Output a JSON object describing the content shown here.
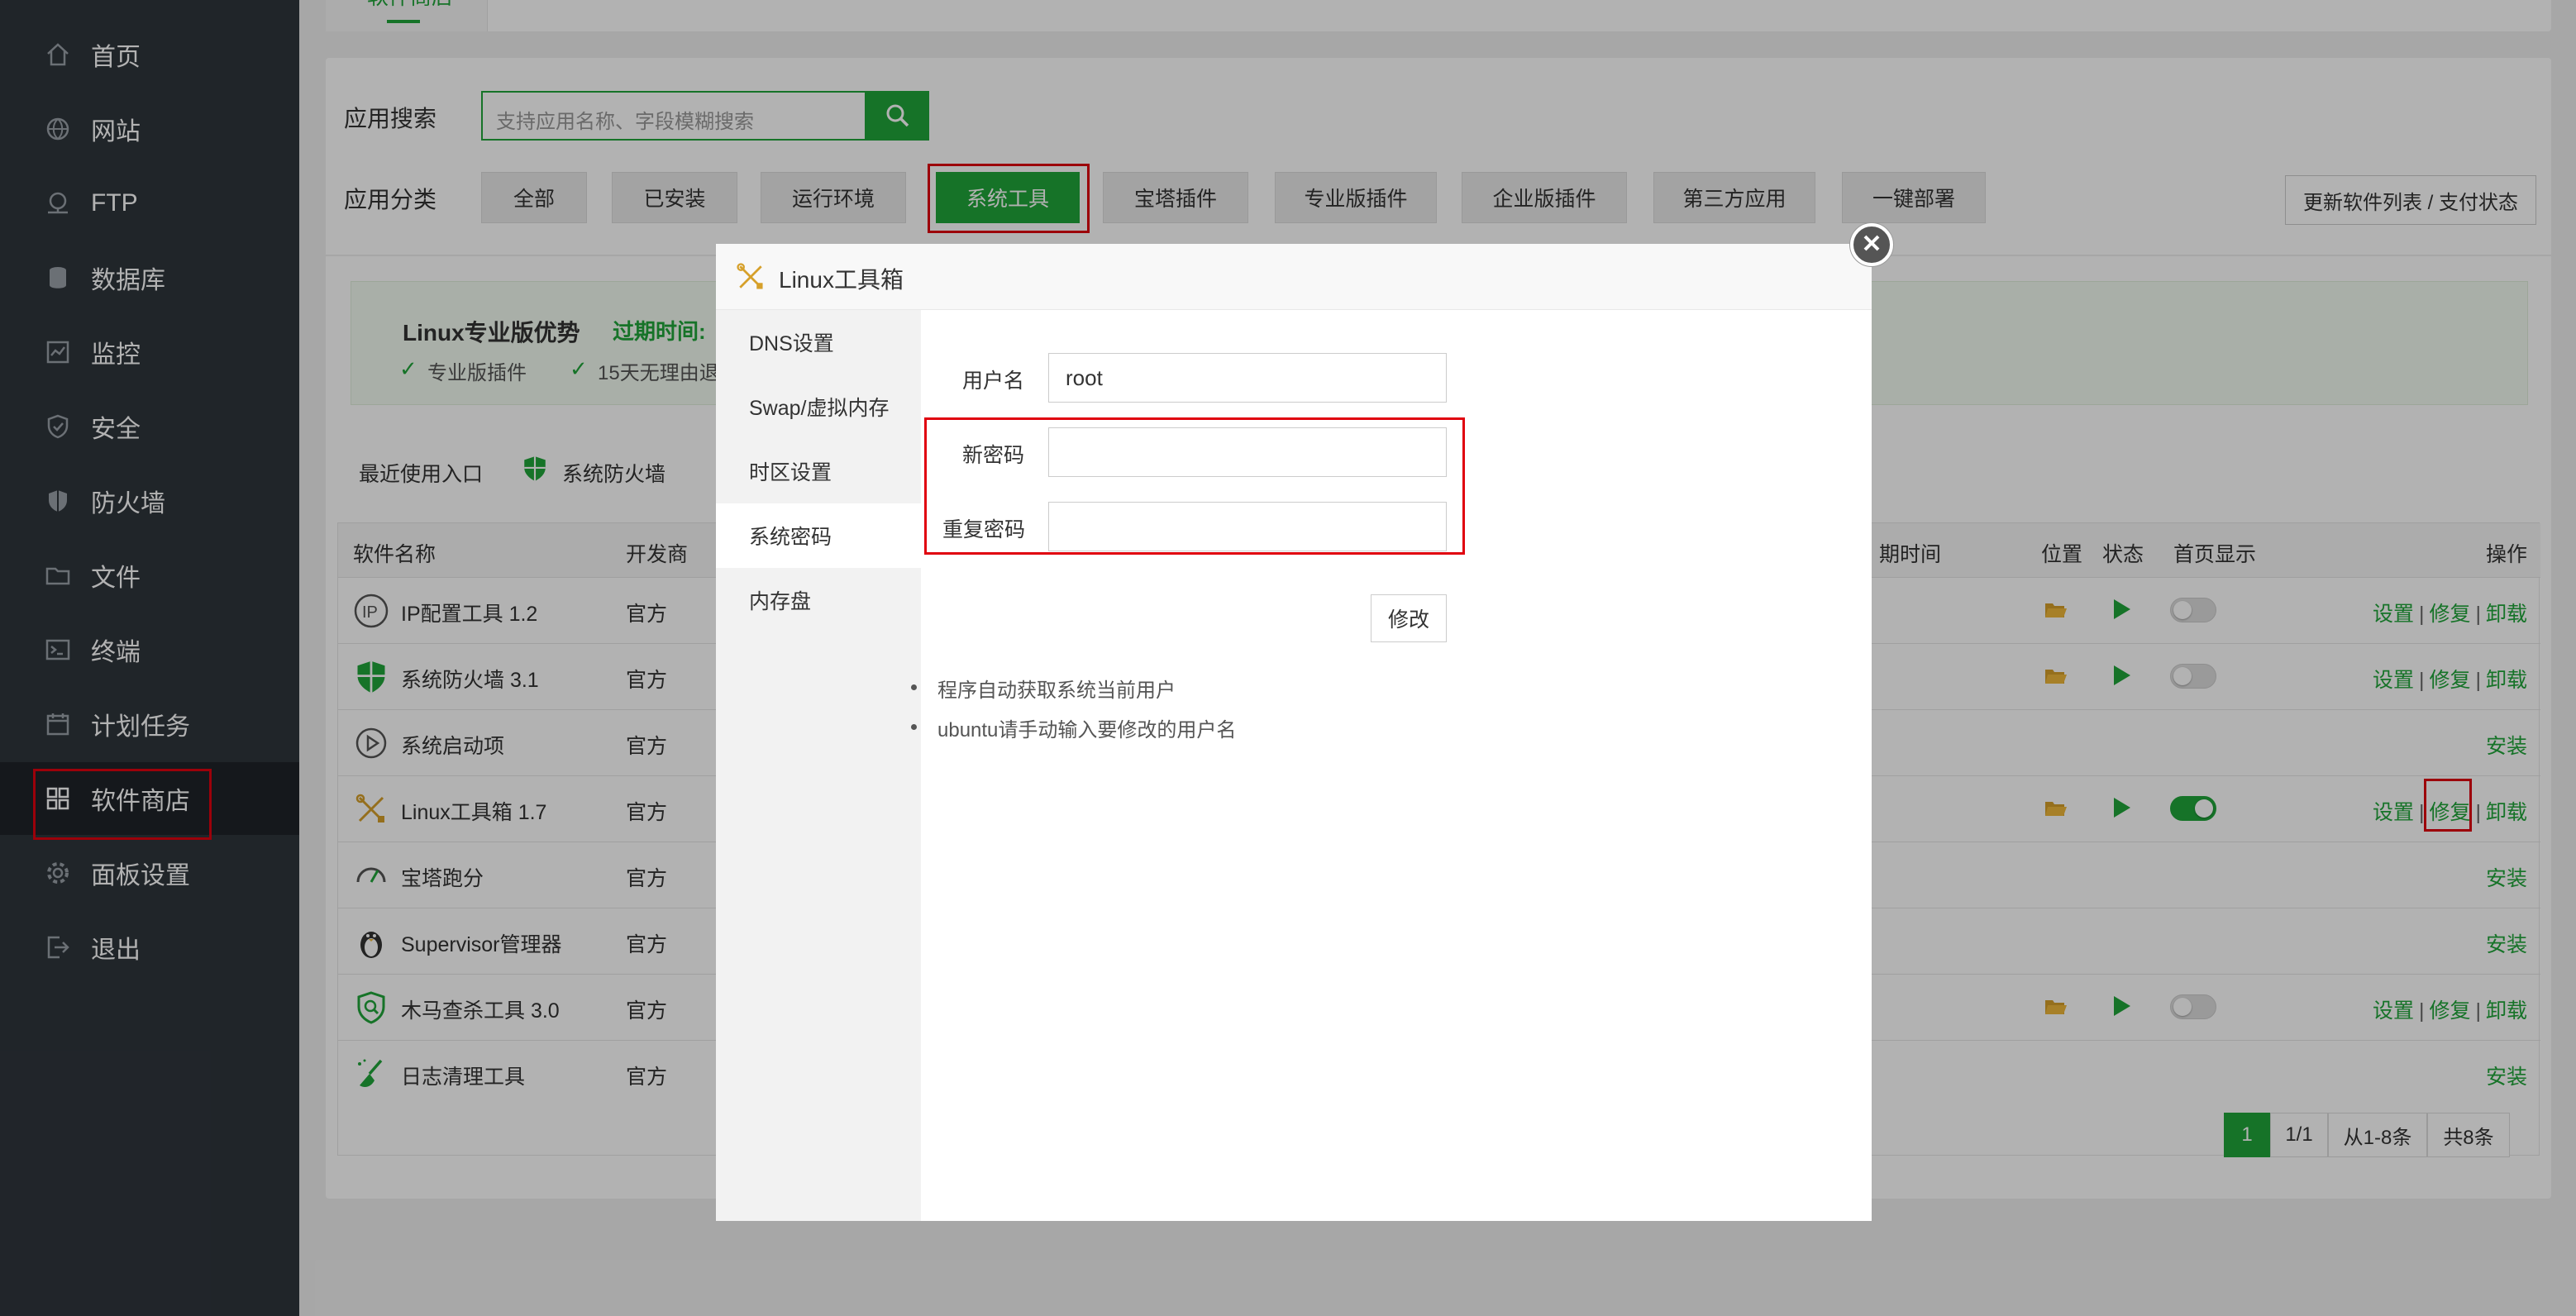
{
  "sidebar": {
    "items": [
      {
        "label": "首页",
        "icon": "home-icon"
      },
      {
        "label": "网站",
        "icon": "globe-icon"
      },
      {
        "label": "FTP",
        "icon": "ftp-icon"
      },
      {
        "label": "数据库",
        "icon": "database-icon"
      },
      {
        "label": "监控",
        "icon": "monitor-icon"
      },
      {
        "label": "安全",
        "icon": "shield-icon"
      },
      {
        "label": "防火墙",
        "icon": "firewall-icon"
      },
      {
        "label": "文件",
        "icon": "folder-icon"
      },
      {
        "label": "终端",
        "icon": "terminal-icon"
      },
      {
        "label": "计划任务",
        "icon": "calendar-icon"
      },
      {
        "label": "软件商店",
        "icon": "grid-icon"
      },
      {
        "label": "面板设置",
        "icon": "gear-icon"
      },
      {
        "label": "退出",
        "icon": "logout-icon"
      }
    ],
    "active": "软件商店"
  },
  "top_tab": {
    "label": "软件商店"
  },
  "search": {
    "label": "应用搜索",
    "placeholder": "支持应用名称、字段模糊搜索"
  },
  "category": {
    "label": "应用分类",
    "buttons": [
      "全部",
      "已安装",
      "运行环境",
      "系统工具",
      "宝塔插件",
      "专业版插件",
      "企业版插件",
      "第三方应用",
      "一键部署"
    ],
    "active": "系统工具",
    "update_button": "更新软件列表 / 支付状态"
  },
  "pro_banner": {
    "title": "Linux专业版优势",
    "expire_label": "过期时间:",
    "features": [
      "专业版插件",
      "15天无理由退"
    ]
  },
  "recent": {
    "label": "最近使用入口",
    "items": [
      "系统防火墙"
    ]
  },
  "table": {
    "headers": {
      "name": "软件名称",
      "dev": "开发商",
      "expire": "期时间",
      "location": "位置",
      "status": "状态",
      "homepage": "首页显示",
      "ops": "操作"
    },
    "rows": [
      {
        "name": "IP配置工具 1.2",
        "dev": "官方",
        "icon": "ip-icon",
        "installed": true,
        "homepage": false
      },
      {
        "name": "系统防火墙 3.1",
        "dev": "官方",
        "icon": "firewall-shield-icon",
        "installed": true,
        "homepage": false
      },
      {
        "name": "系统启动项",
        "dev": "官方",
        "icon": "startup-icon",
        "installed": false
      },
      {
        "name": "Linux工具箱 1.7",
        "dev": "官方",
        "icon": "toolbox-icon",
        "installed": true,
        "homepage": true
      },
      {
        "name": "宝塔跑分",
        "dev": "官方",
        "icon": "speedometer-icon",
        "installed": false
      },
      {
        "name": "Supervisor管理器",
        "dev": "官方",
        "icon": "penguin-icon",
        "installed": false
      },
      {
        "name": "木马查杀工具 3.0",
        "dev": "官方",
        "icon": "trojan-scan-icon",
        "installed": true,
        "homepage": false
      },
      {
        "name": "日志清理工具",
        "dev": "官方",
        "icon": "broom-icon",
        "installed": false
      }
    ],
    "op_labels": {
      "settings": "设置",
      "repair": "修复",
      "uninstall": "卸载",
      "install": "安装",
      "sep": "|"
    }
  },
  "pagination": {
    "current": "1",
    "pages": "1/1",
    "range": "从1-8条",
    "total": "共8条"
  },
  "modal": {
    "title": "Linux工具箱",
    "nav": [
      "DNS设置",
      "Swap/虚拟内存",
      "时区设置",
      "系统密码",
      "内存盘"
    ],
    "active_nav": "系统密码",
    "form": {
      "username_label": "用户名",
      "username_value": "root",
      "new_password_label": "新密码",
      "repeat_password_label": "重复密码",
      "submit": "修改"
    },
    "notes": [
      "程序自动获取系统当前用户",
      "ubuntu请手动输入要修改的用户名"
    ]
  },
  "colors": {
    "accent": "#20a53a",
    "sidebar_bg": "#2f353c",
    "highlight": "#e0000f"
  }
}
